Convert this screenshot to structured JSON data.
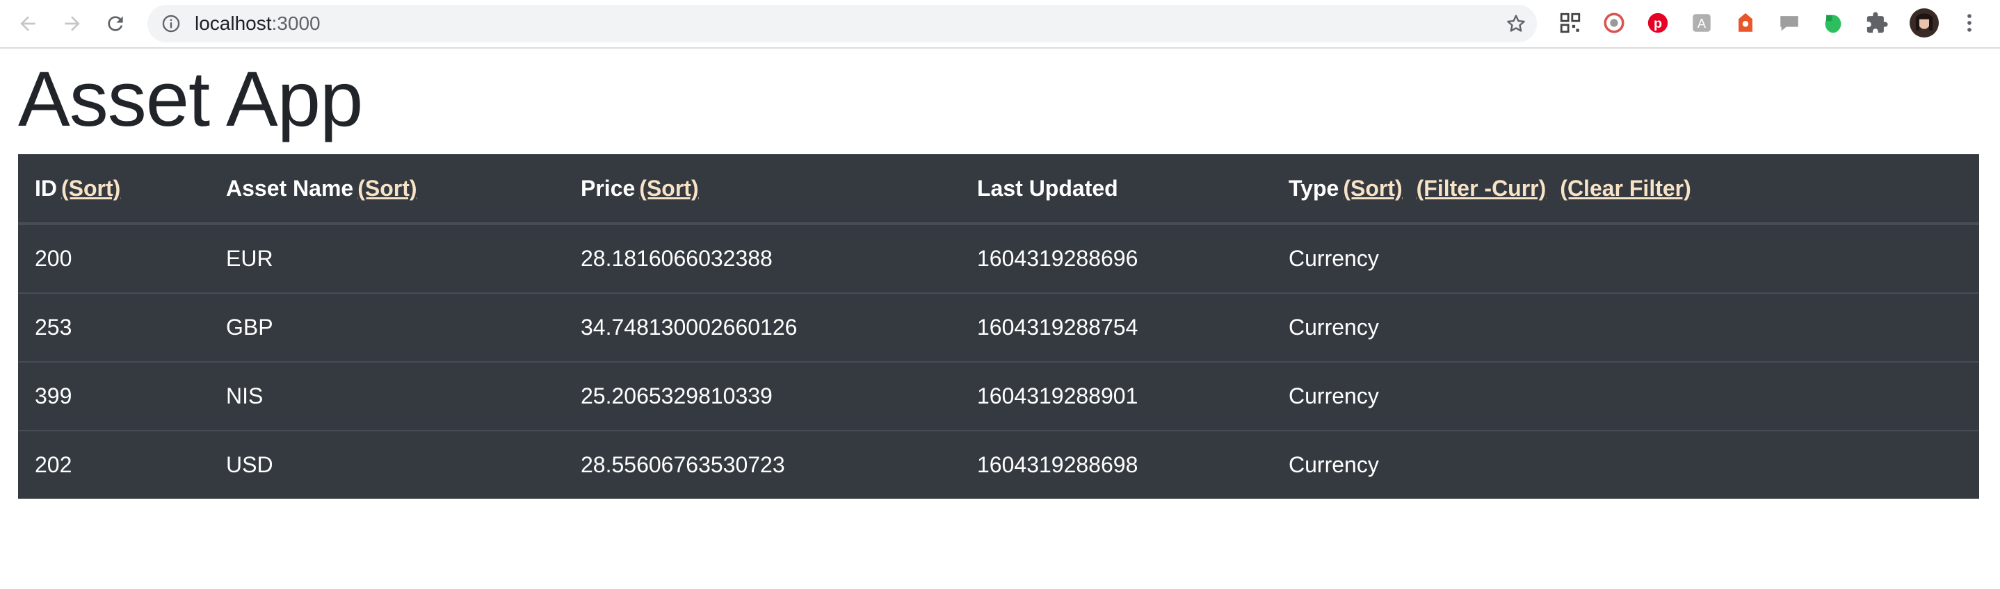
{
  "browser": {
    "url_host": "localhost",
    "url_port": ":3000"
  },
  "page": {
    "title": "Asset App"
  },
  "table": {
    "headers": {
      "id": "ID",
      "name": "Asset Name",
      "price": "Price",
      "updated": "Last Updated",
      "type": "Type"
    },
    "sort_label": "(Sort)",
    "filter_curr_label": "(Filter -Curr)",
    "clear_filter_label": "(Clear Filter)",
    "rows": [
      {
        "id": "200",
        "name": "EUR",
        "price": "28.1816066032388",
        "updated": "1604319288696",
        "type": "Currency"
      },
      {
        "id": "253",
        "name": "GBP",
        "price": "34.748130002660126",
        "updated": "1604319288754",
        "type": "Currency"
      },
      {
        "id": "399",
        "name": "NIS",
        "price": "25.2065329810339",
        "updated": "1604319288901",
        "type": "Currency"
      },
      {
        "id": "202",
        "name": "USD",
        "price": "28.55606763530723",
        "updated": "1604319288698",
        "type": "Currency"
      }
    ]
  },
  "colors": {
    "table_bg": "#343a40",
    "link": "#f8e3c6",
    "row_border": "#454d55"
  }
}
